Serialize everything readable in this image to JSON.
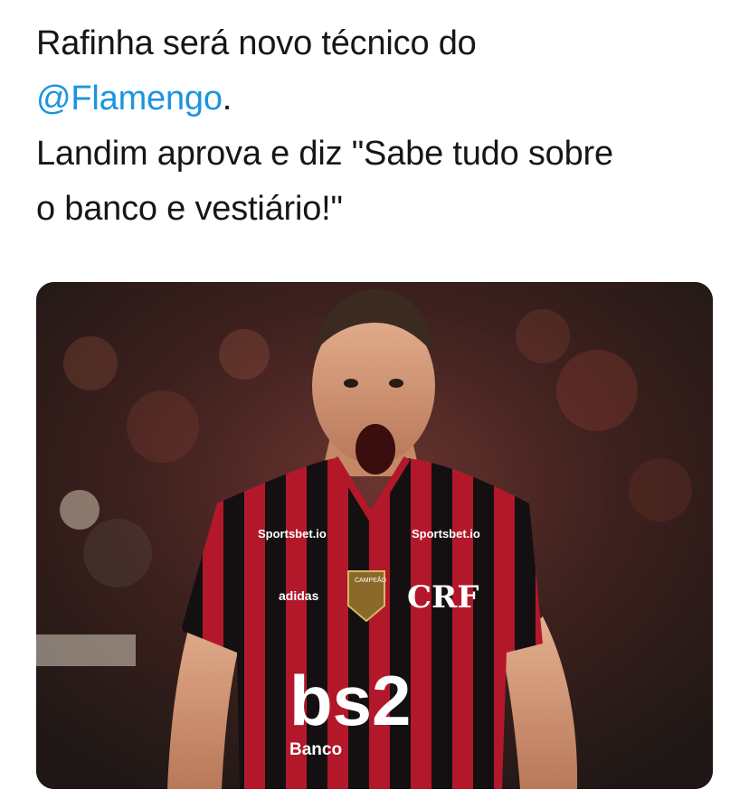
{
  "tweet": {
    "line1": "Rafinha será novo técnico do",
    "mention": "@Flamengo",
    "mention_suffix": ".",
    "line3": "Landim aprova e diz \"Sabe tudo sobre",
    "line4": "o banco e vestiário!\""
  },
  "photo": {
    "sponsor_left": "Sportsbet.io",
    "sponsor_right": "Sportsbet.io",
    "kit_brand": "adidas",
    "badge_text": "CAMPEÃO",
    "main_sponsor": "bs2",
    "main_sponsor_sub": "Banco",
    "club_crest": "CRF",
    "colors": {
      "jersey_red": "#b3182a",
      "jersey_black": "#111111",
      "mention_blue": "#1b95e0"
    }
  }
}
